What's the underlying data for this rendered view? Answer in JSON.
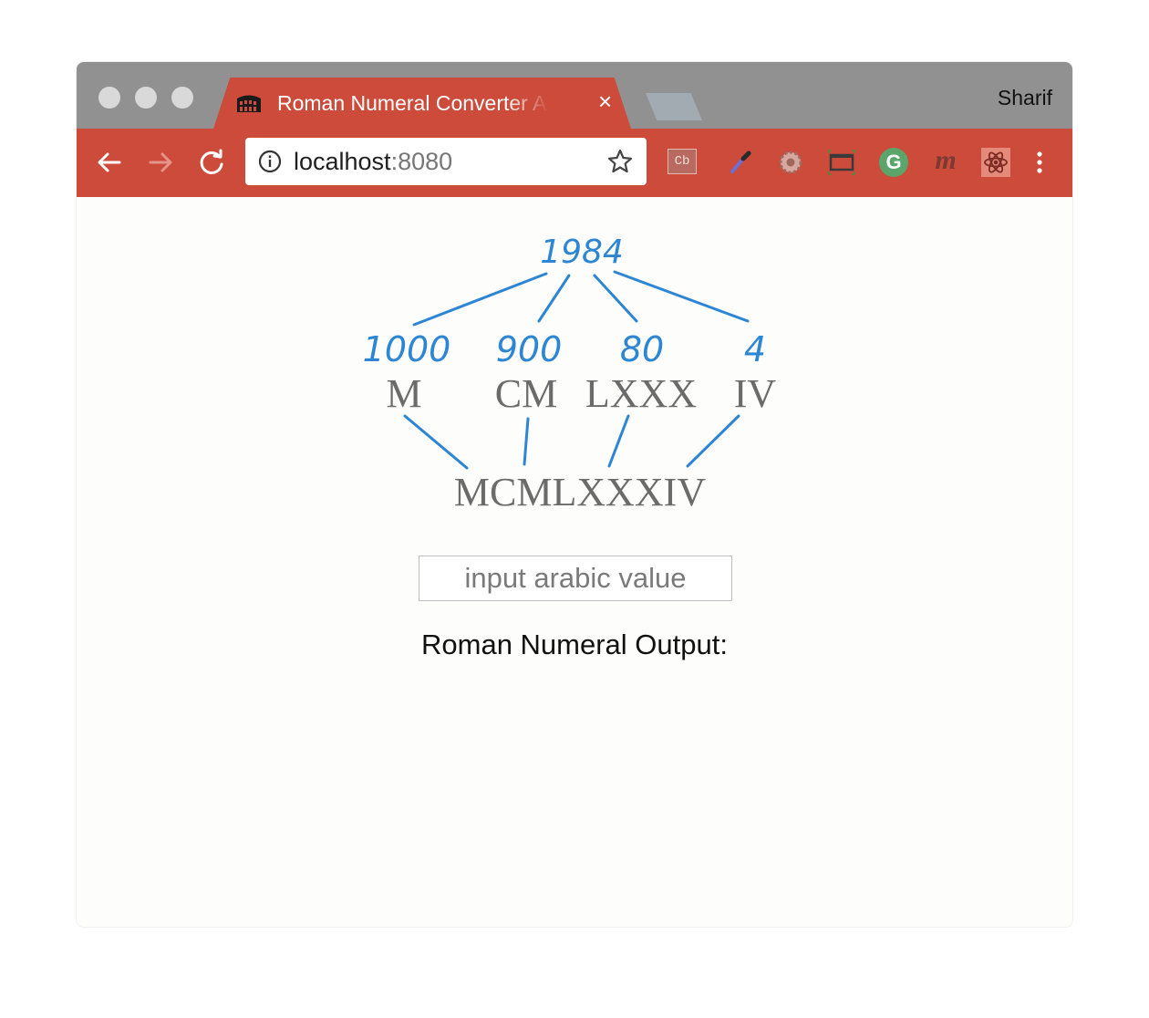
{
  "browser": {
    "tab_title": "Roman Numeral Converter App",
    "tab_close": "×",
    "profile_name": "Sharif",
    "url_host": "localhost",
    "url_port": ":8080",
    "accent_color": "#cc4b3b",
    "titlebar_color": "#919191",
    "extensions": [
      "cb-extension-icon",
      "eyedropper-icon",
      "gear-icon",
      "window-capture-icon",
      "grammarly-icon",
      "m-extension-icon",
      "react-devtools-icon",
      "more-menu-icon"
    ],
    "cb_label": "Cb",
    "m_label": "m",
    "g_label": "G"
  },
  "diagram": {
    "year": "1984",
    "arabic_parts": [
      "1000",
      "900",
      "80",
      "4"
    ],
    "roman_parts": [
      "M",
      "CM",
      "LXXX",
      "IV"
    ],
    "result": "MCMLXXXIV",
    "line_color": "#2d86d3",
    "digit_color": "#2d86d3",
    "roman_color": "#6b6b6b"
  },
  "converter": {
    "input_placeholder": "input arabic value",
    "input_value": "",
    "output_label": "Roman Numeral Output:"
  }
}
